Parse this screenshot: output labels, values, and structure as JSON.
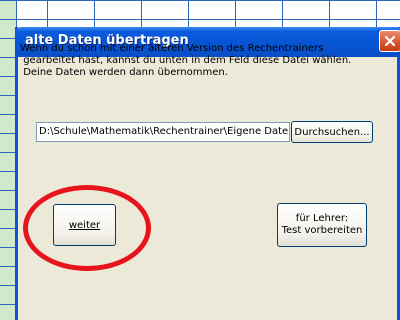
{
  "dialog": {
    "title": "alte Daten übertragen",
    "info_text": "Wenn du schon mit einer älteren Version des Rechentrainers\n gearbeitet hast, kannst du unten in dem Feld diese Datei wählen.\n Deine Daten werden dann übernommen.",
    "path_value": "D:\\Schule\\Mathematik\\Rechentrainer\\Eigene Dateien",
    "browse_label": "Durchsuchen...",
    "continue_label": "weiter",
    "teacher_label": "für Lehrer:\nTest vorbereiten"
  },
  "colors": {
    "titlebar": "#0654d3",
    "dialog_bg": "#ece9d8",
    "annotation": "#e8141c",
    "sheet_grid": "#2c66b8",
    "sheet_column": "#cfeacb"
  },
  "icons": {
    "close": "close-icon"
  }
}
